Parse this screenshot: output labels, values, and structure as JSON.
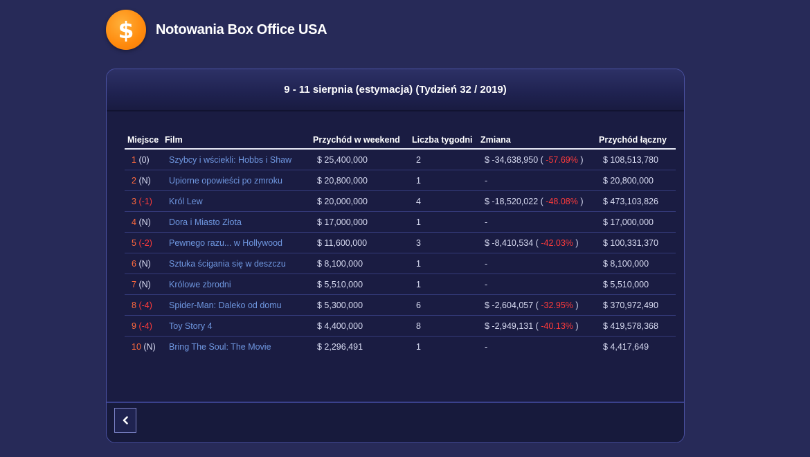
{
  "header": {
    "title": "Notowania Box Office USA",
    "logo_icon": "dollar-icon",
    "logo_symbol": "$"
  },
  "card": {
    "title": "9 - 11 sierpnia (estymacja) (Tydzień 32 / 2019)"
  },
  "table": {
    "columns": [
      "Miejsce",
      "Film",
      "Przychód w weekend",
      "Liczba tygodni",
      "Zmiana",
      "Przychód łączny"
    ],
    "rows": [
      {
        "rank": "1",
        "rank_change": "(0)",
        "rank_change_negative": false,
        "film": "Szybcy i wściekli: Hobbs i Shaw",
        "weekend": "$ 25,400,000",
        "weeks": "2",
        "change": "$ -34,638,950 (",
        "change_pct": "-57.69%",
        "change_close": ")",
        "total": "$ 108,513,780"
      },
      {
        "rank": "2",
        "rank_change": "(N)",
        "rank_change_negative": false,
        "film": "Upiorne opowieści po zmroku",
        "weekend": "$ 20,800,000",
        "weeks": "1",
        "change": "-",
        "change_pct": "",
        "change_close": "",
        "total": "$ 20,800,000"
      },
      {
        "rank": "3",
        "rank_change": "(-1)",
        "rank_change_negative": true,
        "film": "Król Lew",
        "weekend": "$ 20,000,000",
        "weeks": "4",
        "change": "$ -18,520,022 (",
        "change_pct": "-48.08%",
        "change_close": ")",
        "total": "$ 473,103,826"
      },
      {
        "rank": "4",
        "rank_change": "(N)",
        "rank_change_negative": false,
        "film": "Dora i Miasto Złota",
        "weekend": "$ 17,000,000",
        "weeks": "1",
        "change": "-",
        "change_pct": "",
        "change_close": "",
        "total": "$ 17,000,000"
      },
      {
        "rank": "5",
        "rank_change": "(-2)",
        "rank_change_negative": true,
        "film": "Pewnego razu... w Hollywood",
        "weekend": "$ 11,600,000",
        "weeks": "3",
        "change": "$ -8,410,534 (",
        "change_pct": "-42.03%",
        "change_close": ")",
        "total": "$ 100,331,370"
      },
      {
        "rank": "6",
        "rank_change": "(N)",
        "rank_change_negative": false,
        "film": "Sztuka ścigania się w deszczu",
        "weekend": "$ 8,100,000",
        "weeks": "1",
        "change": "-",
        "change_pct": "",
        "change_close": "",
        "total": "$ 8,100,000"
      },
      {
        "rank": "7",
        "rank_change": "(N)",
        "rank_change_negative": false,
        "film": "Królowe zbrodni",
        "weekend": "$ 5,510,000",
        "weeks": "1",
        "change": "-",
        "change_pct": "",
        "change_close": "",
        "total": "$ 5,510,000"
      },
      {
        "rank": "8",
        "rank_change": "(-4)",
        "rank_change_negative": true,
        "film": "Spider-Man: Daleko od domu",
        "weekend": "$ 5,300,000",
        "weeks": "6",
        "change": "$ -2,604,057 (",
        "change_pct": "-32.95%",
        "change_close": ")",
        "total": "$ 370,972,490"
      },
      {
        "rank": "9",
        "rank_change": "(-4)",
        "rank_change_negative": true,
        "film": "Toy Story 4",
        "weekend": "$ 4,400,000",
        "weeks": "8",
        "change": "$ -2,949,131 (",
        "change_pct": "-40.13%",
        "change_close": ")",
        "total": "$ 419,578,368"
      },
      {
        "rank": "10",
        "rank_change": "(N)",
        "rank_change_negative": false,
        "film": "Bring The Soul: The Movie",
        "weekend": "$ 2,296,491",
        "weeks": "1",
        "change": "-",
        "change_pct": "",
        "change_close": "",
        "total": "$ 4,417,649"
      }
    ]
  },
  "footer": {
    "back_icon": "chevron-left-icon"
  },
  "colors": {
    "background": "#272a58",
    "card": "#1a1c42",
    "accent_orange": "#ff8a0d",
    "rank": "#ff6a3d",
    "negative": "#ff3b3b",
    "film_link": "#6f97e0"
  }
}
